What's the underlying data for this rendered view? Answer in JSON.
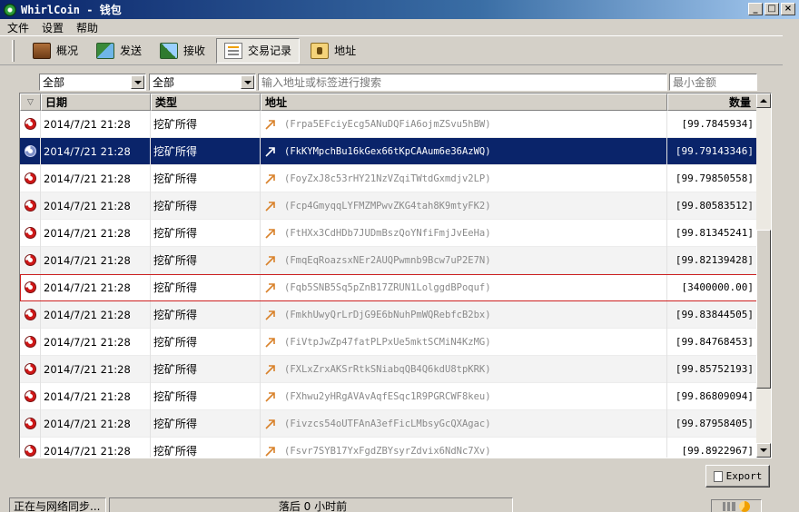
{
  "window": {
    "title": "WhirlCoin - 钱包"
  },
  "menu": [
    "文件",
    "设置",
    "帮助"
  ],
  "toolbar": {
    "overview": "概况",
    "send": "发送",
    "receive": "接收",
    "transactions": "交易记录",
    "address": "地址",
    "active": "transactions"
  },
  "filters": {
    "date_selected": "全部",
    "type_selected": "全部",
    "search_placeholder": "输入地址或标签进行搜索",
    "min_amount_placeholder": "最小金额"
  },
  "table": {
    "headers": {
      "date": "日期",
      "type": "类型",
      "address": "地址",
      "amount": "数量"
    },
    "rows": [
      {
        "date": "2014/7/21 21:28",
        "type": "挖矿所得",
        "address": "(Frpa5EFciyEcg5ANuDQFiA6ojmZSvu5hBW)",
        "amount": "[99.7845934]"
      },
      {
        "date": "2014/7/21 21:28",
        "type": "挖矿所得",
        "address": "(FkKYMpchBu16kGex66tKpCAAum6e36AzWQ)",
        "amount": "[99.79143346]",
        "selected": true
      },
      {
        "date": "2014/7/21 21:28",
        "type": "挖矿所得",
        "address": "(FoyZxJ8c53rHY21NzVZqiTWtdGxmdjv2LP)",
        "amount": "[99.79850558]"
      },
      {
        "date": "2014/7/21 21:28",
        "type": "挖矿所得",
        "address": "(Fcp4GmyqqLYFMZMPwvZKG4tah8K9mtyFK2)",
        "amount": "[99.80583512]"
      },
      {
        "date": "2014/7/21 21:28",
        "type": "挖矿所得",
        "address": "(FtHXx3CdHDb7JUDmBszQoYNfiFmjJvEeHa)",
        "amount": "[99.81345241]"
      },
      {
        "date": "2014/7/21 21:28",
        "type": "挖矿所得",
        "address": "(FmqEqRoazsxNEr2AUQPwmnb9Bcw7uP2E7N)",
        "amount": "[99.82139428]"
      },
      {
        "date": "2014/7/21 21:28",
        "type": "挖矿所得",
        "address": "(Fqb5SNB5Sq5pZnB17ZRUN1LolggdBPoquf)",
        "amount": "[3400000.00]",
        "outlined": true
      },
      {
        "date": "2014/7/21 21:28",
        "type": "挖矿所得",
        "address": "(FmkhUwyQrLrDjG9E6bNuhPmWQRebfcB2bx)",
        "amount": "[99.83844505]"
      },
      {
        "date": "2014/7/21 21:28",
        "type": "挖矿所得",
        "address": "(FiVtpJwZp47fatPLPxUe5mktSCMiN4KzMG)",
        "amount": "[99.84768453]"
      },
      {
        "date": "2014/7/21 21:28",
        "type": "挖矿所得",
        "address": "(FXLxZrxAKSrRtkSNiabqQB4Q6kdU8tpKRK)",
        "amount": "[99.85752193]"
      },
      {
        "date": "2014/7/21 21:28",
        "type": "挖矿所得",
        "address": "(FXhwu2yHRgAVAvAqfESqc1R9PGRCWF8keu)",
        "amount": "[99.86809094]"
      },
      {
        "date": "2014/7/21 21:28",
        "type": "挖矿所得",
        "address": "(Fivzcs54oUTFAnA3efFicLMbsyGcQXAgac)",
        "amount": "[99.87958405]"
      },
      {
        "date": "2014/7/21 21:28",
        "type": "挖矿所得",
        "address": "(Fsvr7SYB17YxFgdZBYsyrZdvix6NdNc7Xv)",
        "amount": "[99.8922967]"
      }
    ]
  },
  "export_label": "Export",
  "status": {
    "sync_text": "正在与网络同步...",
    "behind_text": "落后 0 小时前"
  },
  "colors": {
    "selection": "#0a246a",
    "outline_highlight": "#cc2020",
    "titlebar": "#0a246a"
  }
}
